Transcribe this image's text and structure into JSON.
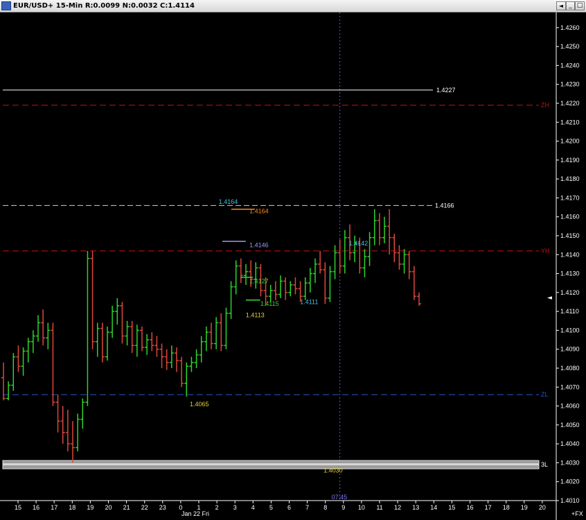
{
  "window": {
    "title": "EUR/USD+ 15-Min R:0.0099 N:0.0032 C:1.4114",
    "buttons": [
      "_",
      "□",
      "×"
    ],
    "scroll_arrow": "◄"
  },
  "colors": {
    "background": "#000000",
    "up_bar": "#2bd62b",
    "down_bar": "#e0473c",
    "yh_line": "#c81414",
    "zh_line": "#c81414",
    "zl_line": "#2a55c8",
    "high_line": "#ffffff",
    "crosshair": "#5a5ad8",
    "label_cyan": "#3fc8e6",
    "label_yellow": "#e8d23a",
    "label_green": "#3ad83a",
    "label_orange": "#ff8c1a",
    "label_lavender": "#9a9aff"
  },
  "chart_data": {
    "type": "candlestick-bar",
    "symbol": "EUR/USD+",
    "interval": "15-Min",
    "ylim": [
      1.401,
      1.4268
    ],
    "y_ticks": [
      1.401,
      1.402,
      1.403,
      1.404,
      1.405,
      1.406,
      1.407,
      1.408,
      1.409,
      1.41,
      1.411,
      1.412,
      1.413,
      1.414,
      1.415,
      1.416,
      1.417,
      1.418,
      1.419,
      1.42,
      1.421,
      1.422,
      1.423,
      1.424,
      1.425,
      1.426
    ],
    "y_tick_labels": [
      "1.4010",
      "1.4020",
      "1.4030",
      "1.4040",
      "1.4050",
      "1.4060",
      "1.4070",
      "1.4080",
      "1.4090",
      "1.4100",
      "1.4110",
      "1.4120",
      "1.4130",
      "1.4140",
      "1.4150",
      "1.4160",
      "1.4170",
      "1.4180",
      "1.4190",
      "1.4200",
      "1.4210",
      "1.4220",
      "1.4230",
      "1.4240",
      "1.4250",
      "1.4260"
    ],
    "x_tick_labels": [
      "15",
      "16",
      "17",
      "18",
      "19",
      "20",
      "21",
      "22",
      "23",
      "0",
      "1",
      "2",
      "3",
      "4",
      "5",
      "6",
      "7",
      "8",
      "9",
      "10",
      "11",
      "12",
      "13",
      "14",
      "15",
      "16",
      "17",
      "18",
      "19",
      "20"
    ],
    "x_date_label": "Jan 22 Fri",
    "crosshair_time": "07:45",
    "bottom_right_label": "+FX",
    "y_cursor_marker": "◄",
    "horizontal_lines": [
      {
        "name": "high",
        "value": 1.4227,
        "label": "1.4227",
        "style": "solid",
        "color_key": "high_line"
      },
      {
        "name": "ZH",
        "value": 1.4219,
        "label": "ZH",
        "style": "dashed",
        "color_key": "zh_line"
      },
      {
        "name": "high2",
        "value": 1.4166,
        "label": "1.4166",
        "style": "dashed",
        "color_key": "high_line"
      },
      {
        "name": "YH",
        "value": 1.4142,
        "label": "YH",
        "style": "dashed",
        "color_key": "yh_line"
      },
      {
        "name": "ZL",
        "value": 1.4066,
        "label": "ZL",
        "style": "dashed",
        "color_key": "zl_line"
      },
      {
        "name": "3L",
        "value": 1.4029,
        "label": "3L",
        "style": "band",
        "color_key": "high_line"
      }
    ],
    "annotations": [
      {
        "text": "1.4142",
        "x_index": 18.3,
        "y": 1.4146,
        "color_key": "label_cyan"
      },
      {
        "text": "1.4111",
        "x_index": 15.6,
        "y": 1.4115,
        "color_key": "label_cyan"
      },
      {
        "text": "1.4065",
        "x_index": 9.5,
        "y": 1.4061,
        "color_key": "label_yellow"
      },
      {
        "text": "1.4030",
        "x_index": 16.9,
        "y": 1.4026,
        "color_key": "label_yellow"
      },
      {
        "text": "1.4164",
        "x_index": 11.1,
        "y": 1.4168,
        "color_key": "label_cyan"
      },
      {
        "text": "1.4164",
        "x_index": 12.8,
        "y": 1.4163,
        "color_key": "label_orange"
      },
      {
        "text": "1.4146",
        "x_index": 12.8,
        "y": 1.4145,
        "color_key": "label_lavender"
      },
      {
        "text": "1.4127",
        "x_index": 12.8,
        "y": 1.4126,
        "color_key": "label_green"
      },
      {
        "text": "1.4115",
        "x_index": 13.4,
        "y": 1.4114,
        "color_key": "label_green"
      },
      {
        "text": "1.4113",
        "x_index": 12.6,
        "y": 1.4108,
        "color_key": "label_yellow"
      }
    ],
    "level_segments": [
      {
        "x_start": 11.8,
        "x_end": 13.1,
        "y": 1.4164,
        "color_key": "label_orange"
      },
      {
        "x_start": 11.3,
        "x_end": 12.6,
        "y": 1.4147,
        "color_key": "label_lavender"
      },
      {
        "x_start": 12.3,
        "x_end": 13.0,
        "y": 1.4128,
        "color_key": "label_green"
      },
      {
        "x_start": 12.6,
        "x_end": 13.4,
        "y": 1.4116,
        "color_key": "label_green"
      }
    ],
    "bars": [
      {
        "o": 1.4075,
        "h": 1.4083,
        "l": 1.4063,
        "c": 1.4064
      },
      {
        "o": 1.4064,
        "h": 1.4073,
        "l": 1.4063,
        "c": 1.4071
      },
      {
        "o": 1.4071,
        "h": 1.4088,
        "l": 1.4068,
        "c": 1.4086
      },
      {
        "o": 1.4086,
        "h": 1.4092,
        "l": 1.4078,
        "c": 1.4081
      },
      {
        "o": 1.4081,
        "h": 1.4091,
        "l": 1.4076,
        "c": 1.4089
      },
      {
        "o": 1.4089,
        "h": 1.4096,
        "l": 1.4083,
        "c": 1.4094
      },
      {
        "o": 1.4094,
        "h": 1.41,
        "l": 1.4088,
        "c": 1.4097
      },
      {
        "o": 1.4097,
        "h": 1.4108,
        "l": 1.4094,
        "c": 1.4104
      },
      {
        "o": 1.4104,
        "h": 1.4111,
        "l": 1.4092,
        "c": 1.4096
      },
      {
        "o": 1.4096,
        "h": 1.4104,
        "l": 1.409,
        "c": 1.41
      },
      {
        "o": 1.41,
        "h": 1.4104,
        "l": 1.406,
        "c": 1.4062
      },
      {
        "o": 1.4062,
        "h": 1.4066,
        "l": 1.4046,
        "c": 1.4052
      },
      {
        "o": 1.4052,
        "h": 1.406,
        "l": 1.404,
        "c": 1.4046
      },
      {
        "o": 1.4046,
        "h": 1.4058,
        "l": 1.4036,
        "c": 1.404
      },
      {
        "o": 1.404,
        "h": 1.4052,
        "l": 1.403,
        "c": 1.4038
      },
      {
        "o": 1.4038,
        "h": 1.4056,
        "l": 1.4036,
        "c": 1.4053
      },
      {
        "o": 1.4053,
        "h": 1.4064,
        "l": 1.4048,
        "c": 1.4062
      },
      {
        "o": 1.4062,
        "h": 1.4142,
        "l": 1.406,
        "c": 1.4138
      },
      {
        "o": 1.4138,
        "h": 1.4142,
        "l": 1.409,
        "c": 1.4094
      },
      {
        "o": 1.4094,
        "h": 1.4104,
        "l": 1.4086,
        "c": 1.4101
      },
      {
        "o": 1.4101,
        "h": 1.4104,
        "l": 1.4083,
        "c": 1.4086
      },
      {
        "o": 1.4086,
        "h": 1.4102,
        "l": 1.4084,
        "c": 1.4099
      },
      {
        "o": 1.4099,
        "h": 1.4113,
        "l": 1.4096,
        "c": 1.411
      },
      {
        "o": 1.411,
        "h": 1.4117,
        "l": 1.4103,
        "c": 1.4113
      },
      {
        "o": 1.4113,
        "h": 1.4115,
        "l": 1.4093,
        "c": 1.4097
      },
      {
        "o": 1.4097,
        "h": 1.4105,
        "l": 1.4092,
        "c": 1.4102
      },
      {
        "o": 1.4102,
        "h": 1.4105,
        "l": 1.4088,
        "c": 1.4092
      },
      {
        "o": 1.4092,
        "h": 1.4103,
        "l": 1.4086,
        "c": 1.41
      },
      {
        "o": 1.41,
        "h": 1.4102,
        "l": 1.4089,
        "c": 1.4091
      },
      {
        "o": 1.4091,
        "h": 1.4098,
        "l": 1.4087,
        "c": 1.4095
      },
      {
        "o": 1.4095,
        "h": 1.4099,
        "l": 1.4089,
        "c": 1.4092
      },
      {
        "o": 1.4092,
        "h": 1.4097,
        "l": 1.4086,
        "c": 1.409
      },
      {
        "o": 1.409,
        "h": 1.4093,
        "l": 1.408,
        "c": 1.4086
      },
      {
        "o": 1.4086,
        "h": 1.409,
        "l": 1.4079,
        "c": 1.4083
      },
      {
        "o": 1.4083,
        "h": 1.4092,
        "l": 1.408,
        "c": 1.4088
      },
      {
        "o": 1.4088,
        "h": 1.4091,
        "l": 1.4078,
        "c": 1.4084
      },
      {
        "o": 1.4084,
        "h": 1.4086,
        "l": 1.407,
        "c": 1.4072
      },
      {
        "o": 1.4072,
        "h": 1.4083,
        "l": 1.4065,
        "c": 1.4081
      },
      {
        "o": 1.4081,
        "h": 1.4086,
        "l": 1.4078,
        "c": 1.4083
      },
      {
        "o": 1.4083,
        "h": 1.409,
        "l": 1.408,
        "c": 1.4087
      },
      {
        "o": 1.4087,
        "h": 1.4097,
        "l": 1.4083,
        "c": 1.4094
      },
      {
        "o": 1.4094,
        "h": 1.4102,
        "l": 1.4089,
        "c": 1.4099
      },
      {
        "o": 1.4099,
        "h": 1.4104,
        "l": 1.409,
        "c": 1.4093
      },
      {
        "o": 1.4093,
        "h": 1.4107,
        "l": 1.409,
        "c": 1.4104
      },
      {
        "o": 1.4104,
        "h": 1.4109,
        "l": 1.4089,
        "c": 1.4092
      },
      {
        "o": 1.4092,
        "h": 1.4112,
        "l": 1.409,
        "c": 1.4109
      },
      {
        "o": 1.4109,
        "h": 1.4126,
        "l": 1.4106,
        "c": 1.4123
      },
      {
        "o": 1.4123,
        "h": 1.4137,
        "l": 1.4119,
        "c": 1.4134
      },
      {
        "o": 1.4134,
        "h": 1.4138,
        "l": 1.4125,
        "c": 1.4129
      },
      {
        "o": 1.4129,
        "h": 1.4135,
        "l": 1.4124,
        "c": 1.4131
      },
      {
        "o": 1.4131,
        "h": 1.4137,
        "l": 1.4123,
        "c": 1.4127
      },
      {
        "o": 1.4127,
        "h": 1.4136,
        "l": 1.4122,
        "c": 1.4133
      },
      {
        "o": 1.4133,
        "h": 1.4135,
        "l": 1.4118,
        "c": 1.4121
      },
      {
        "o": 1.4121,
        "h": 1.4128,
        "l": 1.4113,
        "c": 1.4118
      },
      {
        "o": 1.4118,
        "h": 1.4124,
        "l": 1.4115,
        "c": 1.4121
      },
      {
        "o": 1.4121,
        "h": 1.4126,
        "l": 1.4116,
        "c": 1.4119
      },
      {
        "o": 1.4119,
        "h": 1.4129,
        "l": 1.4117,
        "c": 1.4126
      },
      {
        "o": 1.4126,
        "h": 1.4128,
        "l": 1.4116,
        "c": 1.412
      },
      {
        "o": 1.412,
        "h": 1.4126,
        "l": 1.4118,
        "c": 1.4124
      },
      {
        "o": 1.4124,
        "h": 1.4128,
        "l": 1.4119,
        "c": 1.4122
      },
      {
        "o": 1.4122,
        "h": 1.4126,
        "l": 1.4115,
        "c": 1.4118
      },
      {
        "o": 1.4118,
        "h": 1.4128,
        "l": 1.4116,
        "c": 1.4125
      },
      {
        "o": 1.4125,
        "h": 1.4133,
        "l": 1.412,
        "c": 1.413
      },
      {
        "o": 1.413,
        "h": 1.4138,
        "l": 1.4125,
        "c": 1.4135
      },
      {
        "o": 1.4135,
        "h": 1.4142,
        "l": 1.413,
        "c": 1.4132
      },
      {
        "o": 1.4132,
        "h": 1.4136,
        "l": 1.4114,
        "c": 1.4117
      },
      {
        "o": 1.4117,
        "h": 1.4134,
        "l": 1.4115,
        "c": 1.4131
      },
      {
        "o": 1.4131,
        "h": 1.4145,
        "l": 1.4127,
        "c": 1.4141
      },
      {
        "o": 1.4141,
        "h": 1.4148,
        "l": 1.413,
        "c": 1.4134
      },
      {
        "o": 1.4134,
        "h": 1.4153,
        "l": 1.413,
        "c": 1.4149
      },
      {
        "o": 1.4149,
        "h": 1.4156,
        "l": 1.4137,
        "c": 1.4141
      },
      {
        "o": 1.4141,
        "h": 1.415,
        "l": 1.4136,
        "c": 1.4146
      },
      {
        "o": 1.4146,
        "h": 1.4149,
        "l": 1.413,
        "c": 1.4133
      },
      {
        "o": 1.4133,
        "h": 1.4143,
        "l": 1.4128,
        "c": 1.4139
      },
      {
        "o": 1.4139,
        "h": 1.4152,
        "l": 1.4134,
        "c": 1.4149
      },
      {
        "o": 1.4149,
        "h": 1.4164,
        "l": 1.4145,
        "c": 1.4158
      },
      {
        "o": 1.4158,
        "h": 1.4162,
        "l": 1.4145,
        "c": 1.4149
      },
      {
        "o": 1.4149,
        "h": 1.416,
        "l": 1.4146,
        "c": 1.4155
      },
      {
        "o": 1.4155,
        "h": 1.4164,
        "l": 1.414,
        "c": 1.4149
      },
      {
        "o": 1.4149,
        "h": 1.4151,
        "l": 1.4136,
        "c": 1.4141
      },
      {
        "o": 1.4141,
        "h": 1.4145,
        "l": 1.4132,
        "c": 1.4135
      },
      {
        "o": 1.4135,
        "h": 1.4143,
        "l": 1.413,
        "c": 1.414
      },
      {
        "o": 1.414,
        "h": 1.4142,
        "l": 1.4127,
        "c": 1.4131
      },
      {
        "o": 1.4131,
        "h": 1.4134,
        "l": 1.4116,
        "c": 1.4118
      },
      {
        "o": 1.4118,
        "h": 1.412,
        "l": 1.4113,
        "c": 1.4114
      }
    ]
  }
}
